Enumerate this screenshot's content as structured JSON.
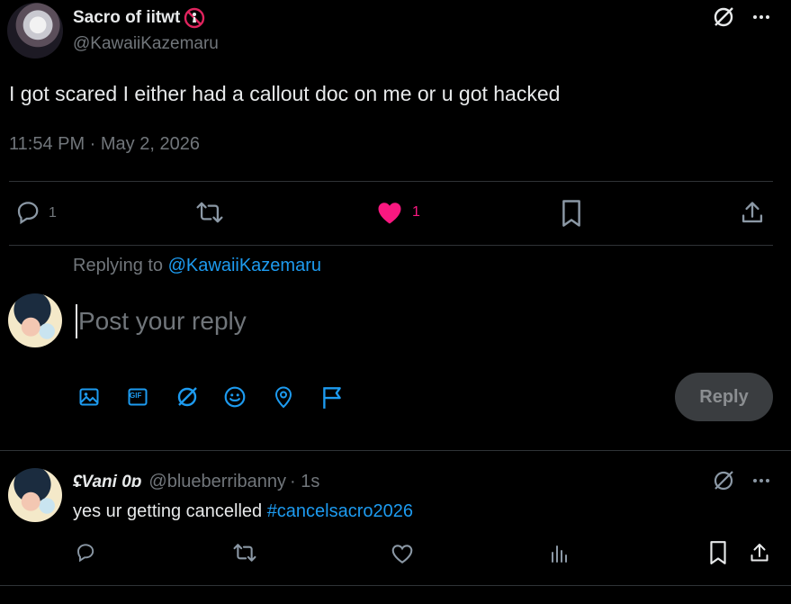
{
  "tweet": {
    "display_name": "Sacro of iitwt",
    "handle": "@KawaiiKazemaru",
    "text": "I got scared I either had a callout doc on me or u got hacked",
    "timestamp": "11:54 PM · May 2, 2026",
    "reply_count": "1",
    "like_count": "1",
    "liked": true
  },
  "composer": {
    "replying_to_prefix": "Replying to",
    "replying_to_handle": "@KawaiiKazemaru",
    "placeholder": "Post your reply",
    "reply_button": "Reply",
    "tool_icons": [
      "image-icon",
      "gif-icon",
      "grok-icon",
      "emoji-icon",
      "location-icon",
      "flag-icon"
    ],
    "gif_text": "GIF"
  },
  "reply": {
    "display_name": "&#x1F480;Vani 0o",
    "display_name_plain": "ʢVani 0ɒ",
    "handle": "@blueberribanny",
    "time": "· 1s",
    "text_prefix": "yes ur getting cancelled ",
    "hashtag": "#cancelsacro2026"
  },
  "colors": {
    "accent": "#1d9bf0",
    "like": "#f91880",
    "background": "#000000",
    "text": "#e7e9ea",
    "muted": "#71767b",
    "divider": "#2f3336",
    "reply_button_bg": "#3a3d40",
    "reply_button_text": "#8b8e91"
  }
}
